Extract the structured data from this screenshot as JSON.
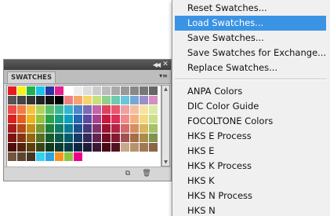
{
  "panel": {
    "collapse_icon": "double-left-arrow-icon",
    "close_icon": "close-icon",
    "tab_label": "SWATCHES",
    "panel_menu_icon": "panel-menu-icon",
    "new_swatch_icon": "new-swatch-icon",
    "trash_icon": "trash-icon",
    "swatches": [
      [
        "#e41c24",
        "#f7ef1c",
        "#1cb44a",
        "#19c2e8",
        "#2837a0",
        "#e21f8f",
        "#ffffff",
        "#eeeeee",
        "#dddddd",
        "#cccccc",
        "#bbbbbb",
        "#aaaaaa",
        "#999999",
        "#888888",
        "#777777",
        "#666666"
      ],
      [
        "#555555",
        "#444444",
        "#333333",
        "#222222",
        "#111111",
        "#000000",
        "#f08080",
        "#f4a46c",
        "#f6d46a",
        "#c7df7c",
        "#8fd08a",
        "#6ccab0",
        "#6ac6d8",
        "#77a7d9",
        "#9a8fca",
        "#d48ec0"
      ],
      [
        "#ea4a48",
        "#f07d46",
        "#f5c143",
        "#b0d45a",
        "#5dbd6a",
        "#3bb896",
        "#33b5cf",
        "#4f87c8",
        "#7a6db8",
        "#c066a8",
        "#e0425e",
        "#e8556e",
        "#f0a0a0",
        "#f3bfa0",
        "#f7e2a0",
        "#d9eaa7"
      ],
      [
        "#d9211f",
        "#e35f1d",
        "#eeb01c",
        "#96c23c",
        "#2aa24a",
        "#14a183",
        "#0aa0c0",
        "#2668b3",
        "#5b4aa0",
        "#a8418e",
        "#c9173f",
        "#dd2f58",
        "#f28a8a",
        "#f3b07e",
        "#f6d97e",
        "#c8e187"
      ],
      [
        "#a61c1a",
        "#b44a17",
        "#c08c14",
        "#74972e",
        "#1f7d3a",
        "#107c66",
        "#087c95",
        "#1d508b",
        "#45397b",
        "#81326d",
        "#9b1231",
        "#b12445",
        "#d46a6a",
        "#d58f5f",
        "#d8b65f",
        "#a7c169"
      ],
      [
        "#7a1513",
        "#853611",
        "#8f680f",
        "#566f22",
        "#175b2b",
        "#0c5b4b",
        "#065b6e",
        "#153b66",
        "#33295a",
        "#5f2550",
        "#720d24",
        "#821b33",
        "#a35050",
        "#a66d48",
        "#a88c48",
        "#7f9450"
      ],
      [
        "#4d0d0c",
        "#54220b",
        "#5a4109",
        "#364615",
        "#0e391b",
        "#083a30",
        "#043a45",
        "#0d2540",
        "#201a39",
        "#3c1733",
        "#480817",
        "#521120",
        "#c6a88a",
        "#b8926c",
        "#a07a56",
        "#8a6646"
      ],
      [
        "#72563d",
        "#5c4530",
        "#463424",
        "#36d1ec",
        "#2aa3e0",
        "#f7941d",
        "#8cc63f",
        "#ec008c",
        "#ffffff",
        "#ffffff",
        "#ffffff",
        "#ffffff",
        "#ffffff",
        "#ffffff",
        "#ffffff",
        "#ffffff"
      ]
    ]
  },
  "menu": {
    "items": [
      {
        "label": "Reset Swatches...",
        "highlighted": false
      },
      {
        "label": "Load Swatches...",
        "highlighted": true
      },
      {
        "label": "Save Swatches...",
        "highlighted": false
      },
      {
        "label": "Save Swatches for Exchange...",
        "highlighted": false
      },
      {
        "label": "Replace Swatches...",
        "highlighted": false
      },
      {
        "label": "ANPA Colors",
        "highlighted": false
      },
      {
        "label": "DIC Color Guide",
        "highlighted": false
      },
      {
        "label": "FOCOLTONE Colors",
        "highlighted": false
      },
      {
        "label": "HKS E Process",
        "highlighted": false
      },
      {
        "label": "HKS E",
        "highlighted": false
      },
      {
        "label": "HKS K Process",
        "highlighted": false
      },
      {
        "label": "HKS K",
        "highlighted": false
      },
      {
        "label": "HKS N Process",
        "highlighted": false
      },
      {
        "label": "HKS N",
        "highlighted": false
      }
    ],
    "highlight_color": "#3b93e4"
  }
}
